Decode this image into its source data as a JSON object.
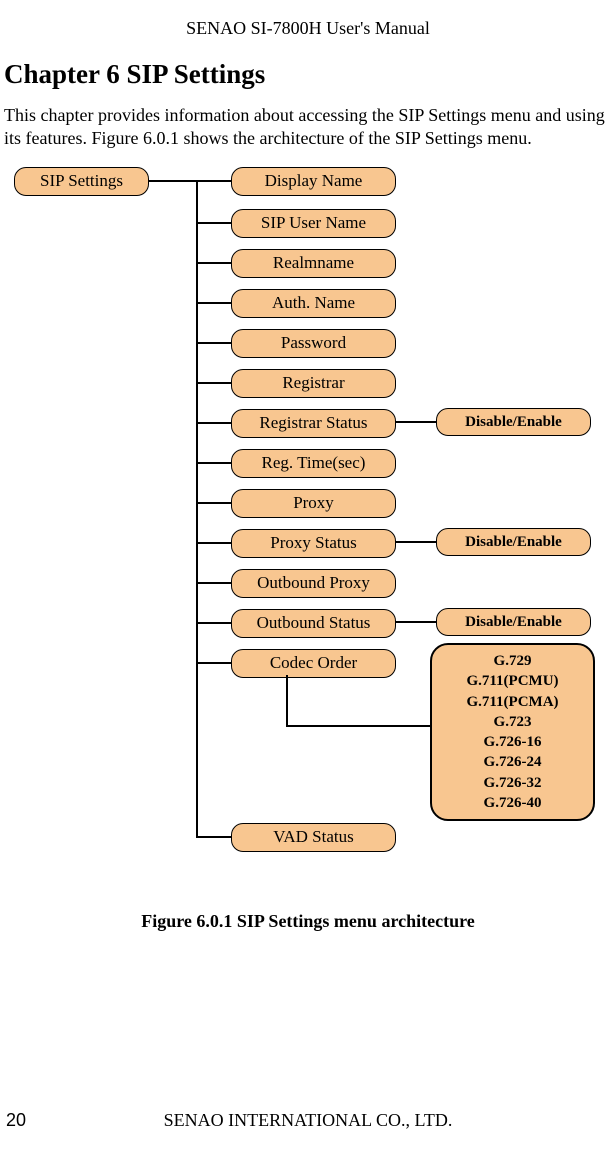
{
  "header": "SENAO SI-7800H User's Manual",
  "chapter": "Chapter 6 SIP Settings",
  "intro": "This chapter provides information about accessing the SIP Settings menu and using its features. Figure 6.0.1 shows the architecture of the SIP Settings menu.",
  "diagram": {
    "root": "SIP Settings",
    "items": [
      "Display Name",
      "SIP User Name",
      "Realmname",
      "Auth. Name",
      "Password",
      "Registrar",
      "Registrar Status",
      "Reg. Time(sec)",
      "Proxy",
      "Proxy Status",
      "Outbound Proxy",
      "Outbound Status",
      "Codec Order",
      "VAD Status"
    ],
    "sub_labels": {
      "registrar_status": "Disable/Enable",
      "proxy_status": "Disable/Enable",
      "outbound_status": "Disable/Enable"
    },
    "codecs": [
      "G.729",
      "G.711(PCMU)",
      "G.711(PCMA)",
      "G.723",
      "G.726-16",
      "G.726-24",
      "G.726-32",
      "G.726-40"
    ]
  },
  "figure_caption": "Figure 6.0.1 SIP Settings menu architecture",
  "footer": {
    "page": "20",
    "company": "SENAO INTERNATIONAL CO., LTD."
  }
}
